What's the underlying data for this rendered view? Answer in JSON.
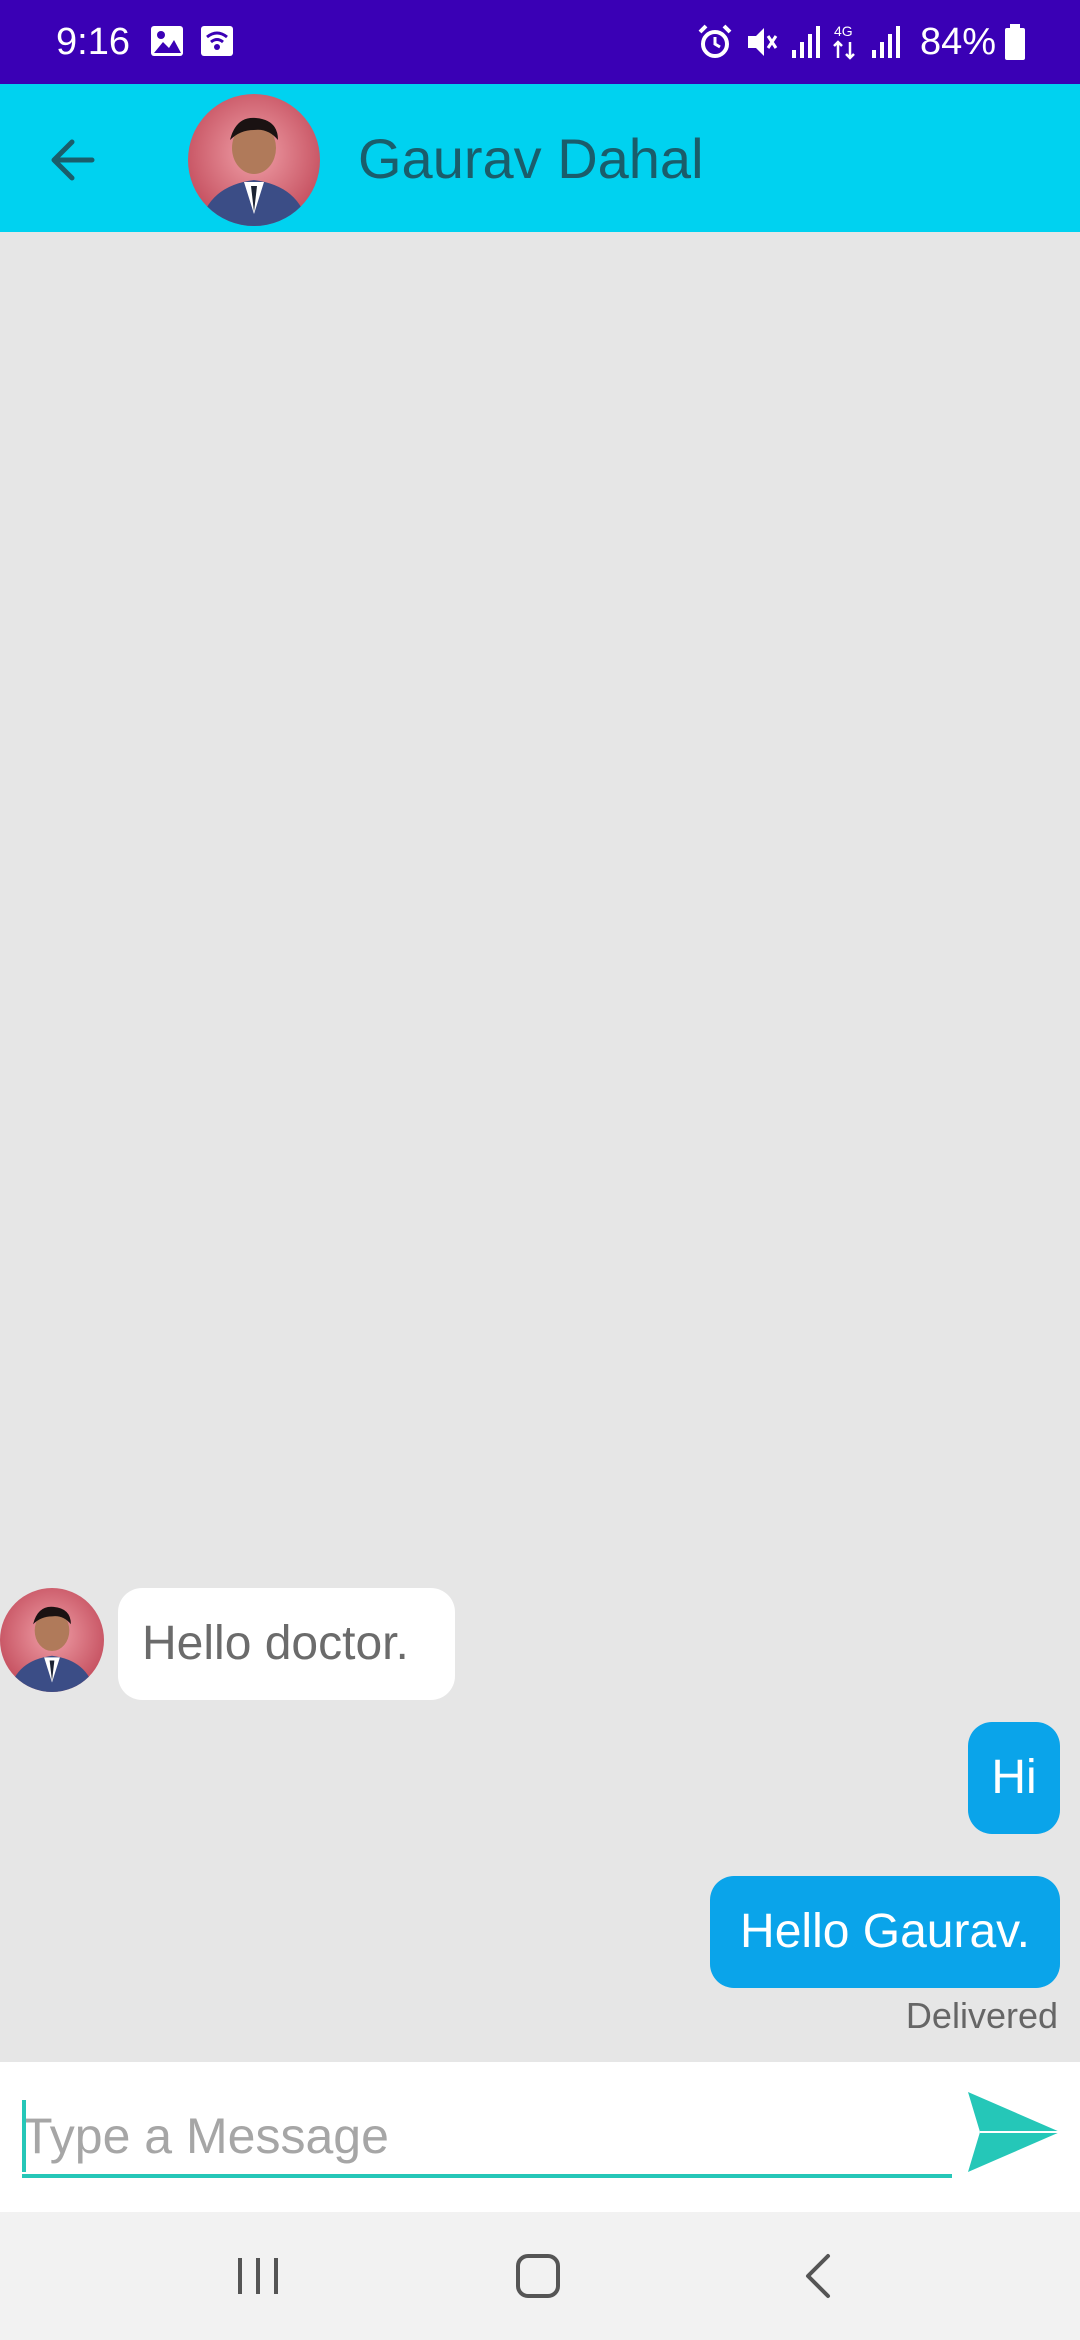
{
  "status_bar": {
    "time": "9:16",
    "battery": "84%",
    "icons": [
      "gallery-icon",
      "wifi-calling-icon",
      "alarm-icon",
      "mute-icon",
      "signal-icon",
      "4g-data-icon",
      "signal-icon",
      "battery-icon"
    ]
  },
  "header": {
    "back_icon": "back-arrow-icon",
    "title": "Gaurav Dahal"
  },
  "messages": [
    {
      "direction": "incoming",
      "text": "Hello doctor."
    },
    {
      "direction": "outgoing",
      "text": "Hi"
    },
    {
      "direction": "outgoing",
      "text": "Hello Gaurav.",
      "status": "Delivered"
    }
  ],
  "input": {
    "value": "",
    "placeholder": "Type a Message",
    "send_icon": "send-icon"
  },
  "nav": {
    "recents_icon": "recents-icon",
    "home_icon": "home-icon",
    "back_icon": "back-icon"
  },
  "colors": {
    "status_bar": "#3a00b5",
    "app_bar": "#00d2f0",
    "title_text": "#1a5d6b",
    "outgoing_bubble": "#0aa4ea",
    "accent": "#25c7b8",
    "chat_background": "#e6e6e6"
  }
}
